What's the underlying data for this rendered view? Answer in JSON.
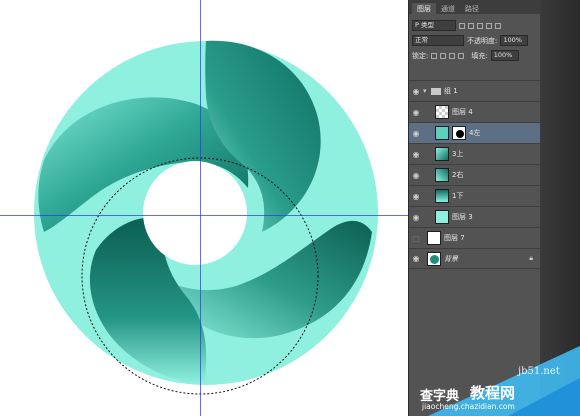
{
  "panel": {
    "tabs": [
      "图层",
      "通道",
      "路径"
    ],
    "filter_kind": "P 类型",
    "blend_mode": "正常",
    "opacity_label": "不透明度:",
    "opacity_value": "100%",
    "lock_label": "锁定:",
    "fill_label": "填充:",
    "fill_value": "100%",
    "layers": [
      {
        "name": "组 1",
        "type": "group",
        "visible": true
      },
      {
        "name": "图层 4",
        "type": "layer",
        "visible": true
      },
      {
        "name": "4左",
        "type": "masked",
        "visible": true,
        "selected": true
      },
      {
        "name": "3上",
        "type": "layer",
        "visible": true
      },
      {
        "name": "2右",
        "type": "layer",
        "visible": true
      },
      {
        "name": "1下",
        "type": "layer",
        "visible": true
      },
      {
        "name": "图层 3",
        "type": "layer",
        "visible": true
      },
      {
        "name": "图层 7",
        "type": "layer",
        "visible": false
      },
      {
        "name": "背景",
        "type": "background",
        "visible": true,
        "locked": true
      }
    ]
  },
  "watermark": {
    "line1": "查字典",
    "line2": "教程网",
    "site": "jb51.net",
    "url": "jiaocheng.chazidian.com"
  },
  "colors": {
    "ring_light": "#8ff0df",
    "teal_dark": "#0f6e62",
    "teal_mid": "#2fa896",
    "panel_bg": "#535353",
    "selection_bg": "#5c6f85",
    "guide": "#3535ff"
  }
}
